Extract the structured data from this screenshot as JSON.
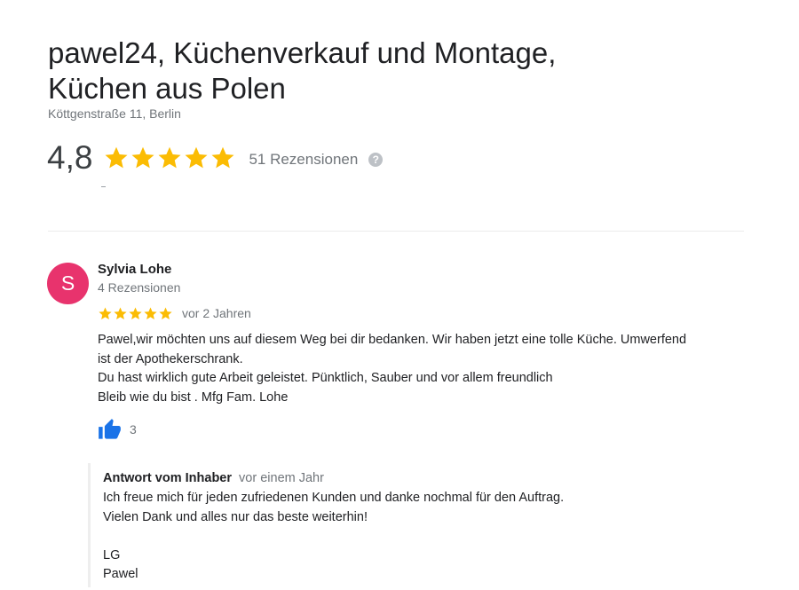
{
  "business": {
    "title_line1": "pawel24, Küchenverkauf und Montage,",
    "title_line2": "Küchen aus Polen",
    "address": "Köttgenstraße 11, Berlin",
    "rating": "4,8",
    "review_count": "51 Rezensionen",
    "star_color": "#fbbc04",
    "help_icon": "question-mark-circle-icon"
  },
  "review": {
    "avatar_letter": "S",
    "avatar_color": "#e8336d",
    "author": "Sylvia Lohe",
    "author_meta": "4 Rezensionen",
    "stars": 5,
    "date": "vor 2 Jahren",
    "text_lines": [
      "Pawel,wir möchten uns auf diesem Weg bei dir bedanken. Wir haben jetzt eine tolle Küche. Umwerfend",
      "ist der Apothekerschrank.",
      "Du hast wirklich gute Arbeit geleistet. Pünktlich, Sauber und vor allem freundlich",
      "Bleib wie du bist .  Mfg Fam. Lohe"
    ],
    "like_icon": "thumbs-up-icon",
    "like_color": "#1a73e8",
    "likes": "3"
  },
  "owner_reply": {
    "label": "Antwort vom Inhaber",
    "date": "vor einem Jahr",
    "lines": [
      "Ich freue mich für jeden zufriedenen Kunden und danke nochmal für den Auftrag.",
      "Vielen Dank und alles nur das beste weiterhin!",
      "",
      "LG",
      "Pawel"
    ]
  }
}
